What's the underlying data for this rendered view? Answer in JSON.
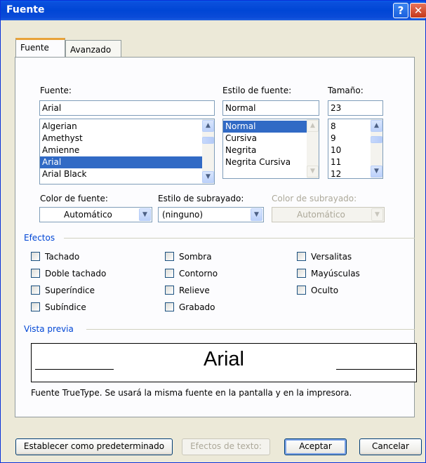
{
  "window": {
    "title": "Fuente"
  },
  "tabs": [
    {
      "label": "Fuente",
      "active": true
    },
    {
      "label": "Avanzado",
      "active": false
    }
  ],
  "font": {
    "label": "Fuente:",
    "value": "Arial",
    "items": [
      "Algerian",
      "Amethyst",
      "Amienne",
      "Arial",
      "Arial Black"
    ],
    "selected": "Arial"
  },
  "style": {
    "label": "Estilo de fuente:",
    "value": "Normal",
    "items": [
      "Normal",
      "Cursiva",
      "Negrita",
      "Negrita Cursiva"
    ],
    "selected": "Normal"
  },
  "size": {
    "label": "Tamaño:",
    "value": "23",
    "items": [
      "8",
      "9",
      "10",
      "11",
      "12"
    ]
  },
  "color": {
    "label": "Color de fuente:",
    "value": "Automático"
  },
  "underline_style": {
    "label": "Estilo de subrayado:",
    "value": "(ninguno)"
  },
  "underline_color": {
    "label": "Color de subrayado:",
    "value": "Automático"
  },
  "effects": {
    "title": "Efectos",
    "col1": [
      "Tachado",
      "Doble tachado",
      "Superíndice",
      "Subíndice"
    ],
    "col2": [
      "Sombra",
      "Contorno",
      "Relieve",
      "Grabado"
    ],
    "col3": [
      "Versalitas",
      "Mayúsculas",
      "Oculto"
    ]
  },
  "preview": {
    "title": "Vista previa",
    "sample": "Arial",
    "description": "Fuente TrueType. Se usará la misma fuente en la pantalla y en la impresora."
  },
  "buttons": {
    "set_default": "Establecer como predeterminado",
    "text_effects": "Efectos de texto:",
    "accept": "Aceptar",
    "cancel": "Cancelar"
  },
  "colors": {
    "accent": "#0046d5",
    "selection": "#316ac5"
  }
}
